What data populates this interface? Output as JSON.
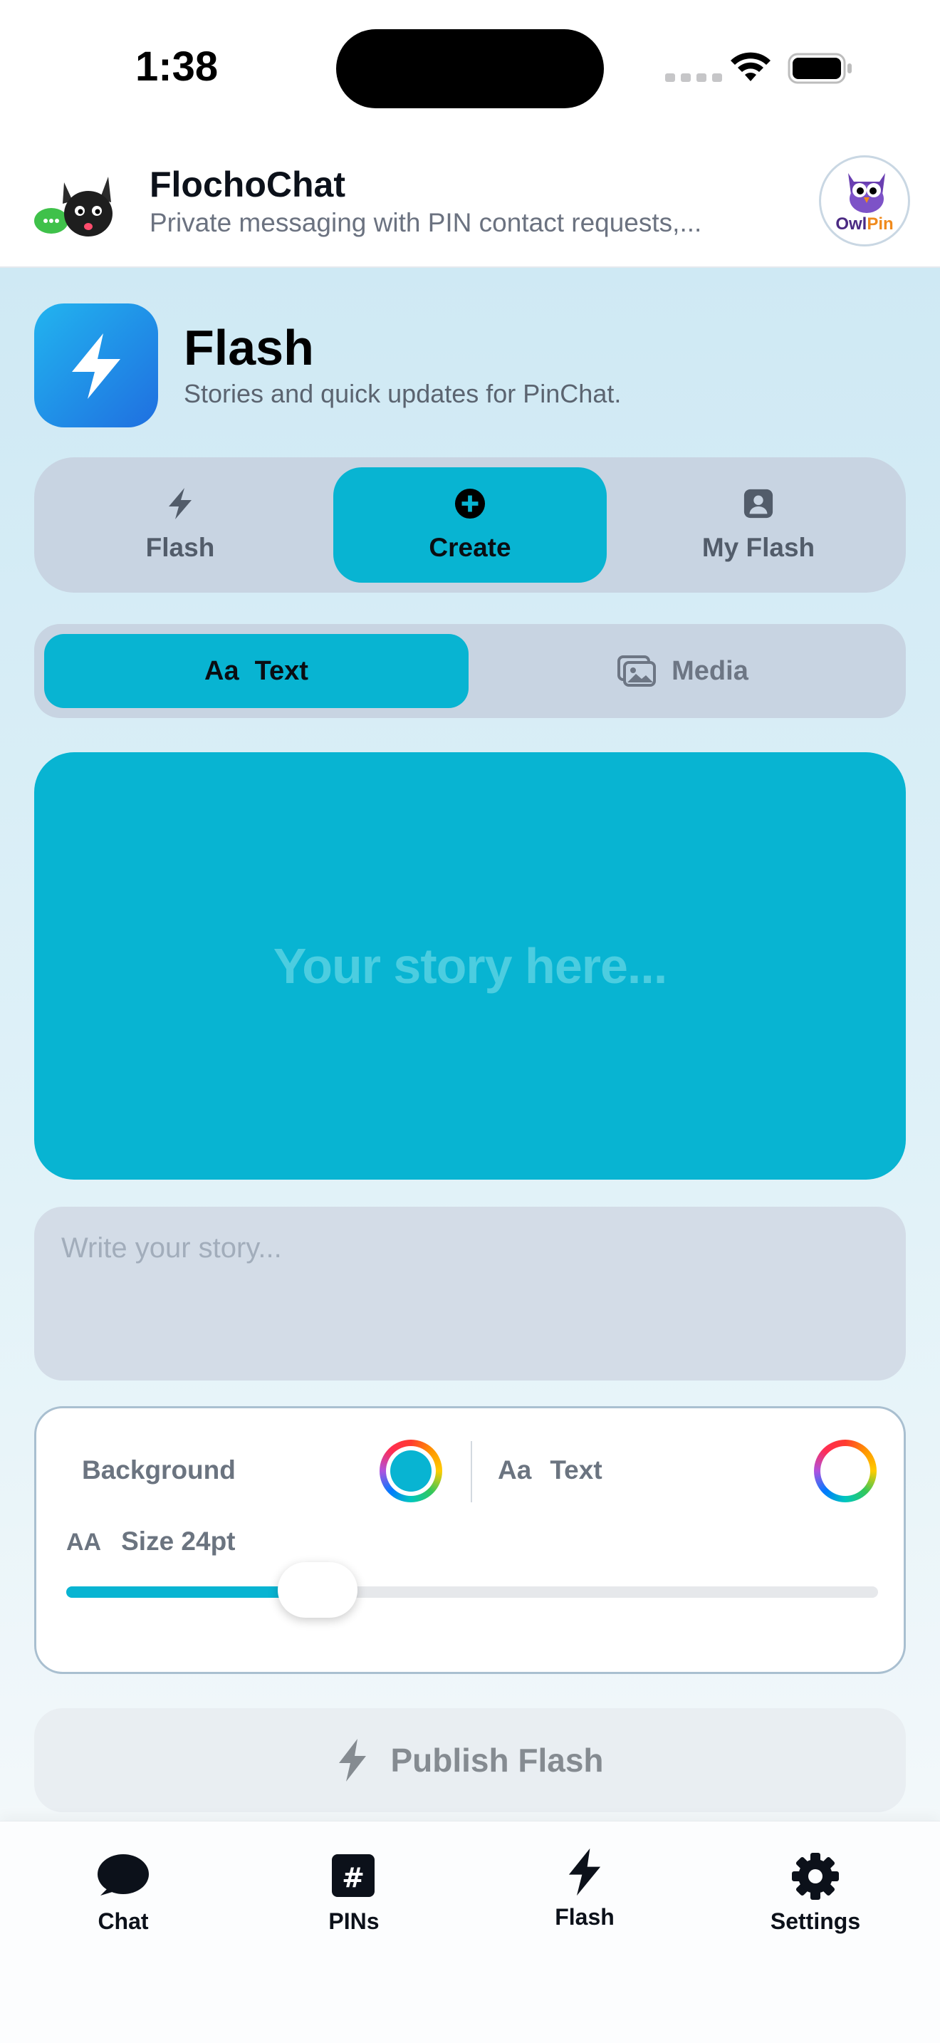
{
  "status_bar": {
    "time": "1:38"
  },
  "header": {
    "app_name": "FlochoChat",
    "tagline": "Private messaging with PIN contact requests,...",
    "partner_brand": {
      "owl": "Owl",
      "pin": "Pin"
    }
  },
  "section": {
    "title": "Flash",
    "subtitle": "Stories and quick updates for PinChat."
  },
  "segments": {
    "items": [
      {
        "label": "Flash",
        "icon": "bolt-icon"
      },
      {
        "label": "Create",
        "icon": "plus-circle-icon",
        "selected": true
      },
      {
        "label": "My Flash",
        "icon": "person-square-icon"
      }
    ]
  },
  "mode": {
    "text_prefix": "Aa",
    "text_label": "Text",
    "media_label": "Media",
    "selected": "Text"
  },
  "preview": {
    "placeholder": "Your story here..."
  },
  "story_input": {
    "placeholder": "Write your story...",
    "value": ""
  },
  "style_panel": {
    "background_label": "Background",
    "background_color": "#08b4d2",
    "text_prefix": "Aa",
    "text_label": "Text",
    "text_color": "#ffffff",
    "size_prefix": "AA",
    "size_label": "Size 24pt",
    "size_fraction": 0.31
  },
  "publish": {
    "label": "Publish Flash"
  },
  "tab_bar": {
    "items": [
      {
        "label": "Chat",
        "icon": "chat-bubble-icon"
      },
      {
        "label": "PINs",
        "icon": "number-square-icon"
      },
      {
        "label": "Flash",
        "icon": "bolt-icon",
        "selected": true
      },
      {
        "label": "Settings",
        "icon": "gear-icon"
      }
    ]
  },
  "colors": {
    "accent": "#08b4d2",
    "segment_bg": "#c8d4e2",
    "flash_badge": "#1f8ae8"
  }
}
